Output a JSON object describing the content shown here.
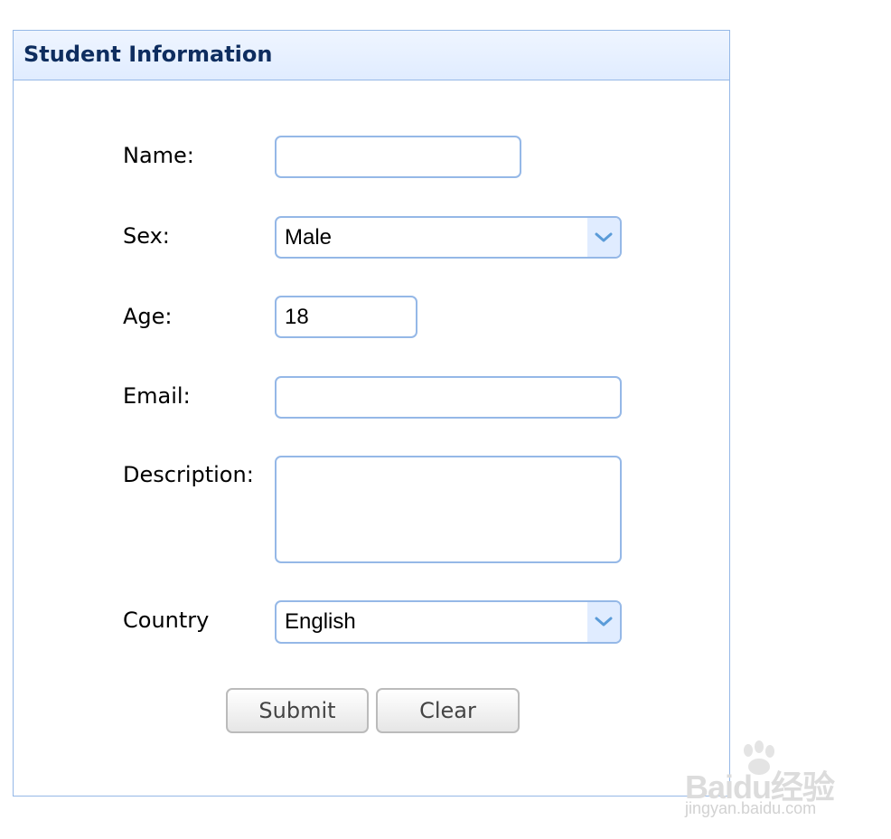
{
  "panel": {
    "title": "Student Information"
  },
  "form": {
    "name": {
      "label": "Name:",
      "value": ""
    },
    "sex": {
      "label": "Sex:",
      "value": "Male"
    },
    "age": {
      "label": "Age:",
      "value": "18"
    },
    "email": {
      "label": "Email:",
      "value": ""
    },
    "description": {
      "label": "Description:",
      "value": ""
    },
    "country": {
      "label": "Country",
      "value": "English"
    }
  },
  "buttons": {
    "submit": "Submit",
    "clear": "Clear"
  },
  "watermark": {
    "logo": "Baidu经验",
    "url": "jingyan.baidu.com"
  },
  "colors": {
    "border": "#95b8e7",
    "header_bg": "#e0ecff",
    "title": "#0e2d5f",
    "arrow": "#5a9bd8"
  },
  "icons": {
    "combo_arrow": "chevron-down-icon"
  }
}
